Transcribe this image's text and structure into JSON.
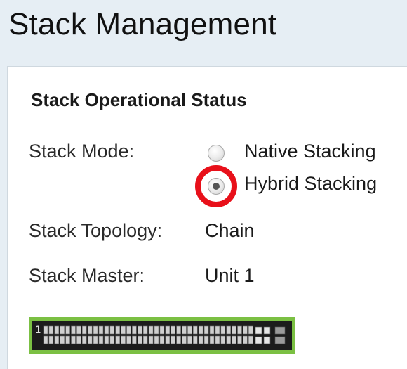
{
  "page": {
    "title": "Stack Management"
  },
  "status_section": {
    "title": "Stack Operational Status",
    "stack_mode": {
      "label": "Stack Mode:",
      "options": [
        {
          "label": "Native Stacking",
          "selected": false
        },
        {
          "label": "Hybrid Stacking",
          "selected": true
        }
      ]
    },
    "stack_topology": {
      "label": "Stack Topology:",
      "value": "Chain"
    },
    "stack_master": {
      "label": "Stack Master:",
      "value": "Unit 1"
    }
  },
  "stack_diagram": {
    "unit_number": "1",
    "frame_color": "#7bc043",
    "highlight_color": "#e8101a"
  }
}
